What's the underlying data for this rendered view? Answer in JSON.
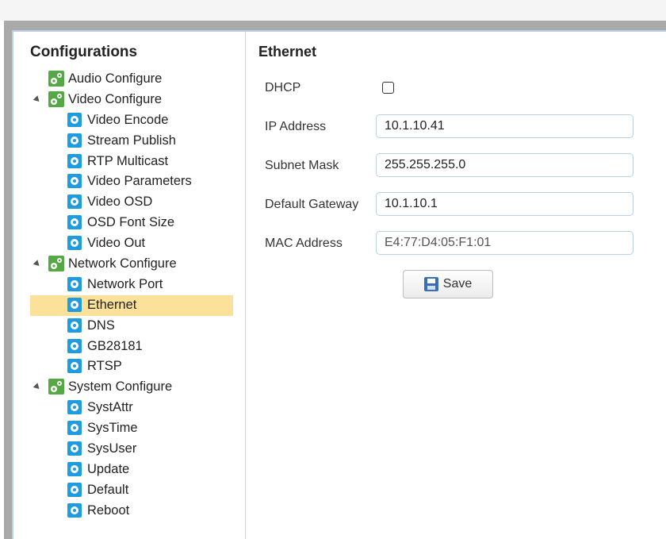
{
  "sidebar": {
    "title": "Configurations",
    "groups": [
      {
        "label": "Audio Configure"
      },
      {
        "label": "Video Configure",
        "children": [
          "Video Encode",
          "Stream Publish",
          "RTP Multicast",
          "Video Parameters",
          "Video OSD",
          "OSD Font Size",
          "Video Out"
        ]
      },
      {
        "label": "Network Configure",
        "children": [
          "Network Port",
          "Ethernet",
          "DNS",
          "GB28181",
          "RTSP"
        ]
      },
      {
        "label": "System Configure",
        "children": [
          "SystAttr",
          "SysTime",
          "SysUser",
          "Update",
          "Default",
          "Reboot"
        ]
      }
    ],
    "selected_item": "Ethernet"
  },
  "main": {
    "title": "Ethernet",
    "dhcp_label": "DHCP",
    "dhcp_checked": false,
    "ip_label": "IP Address",
    "ip_value": "10.1.10.41",
    "mask_label": "Subnet Mask",
    "mask_value": "255.255.255.0",
    "gateway_label": "Default Gateway",
    "gateway_value": "10.1.10.1",
    "mac_label": "MAC Address",
    "mac_value": "E4:77:D4:05:F1:01",
    "save_label": "Save"
  },
  "colors": {
    "selected_bg": "#fbe19a",
    "group_icon": "#55a845",
    "child_icon": "#1f9be0",
    "field_border": "#b9cfe6"
  }
}
